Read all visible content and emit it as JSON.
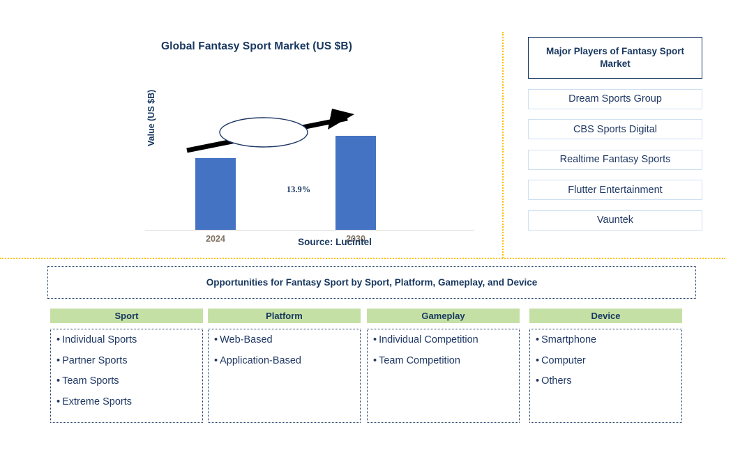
{
  "chart_data": {
    "type": "bar",
    "title": "Global Fantasy Sport Market (US $B)",
    "xlabel": "",
    "ylabel": "Value (US $B)",
    "categories": [
      "2024",
      "2030"
    ],
    "values": [
      71,
      93
    ],
    "ylim": [
      0,
      110
    ],
    "grid": false,
    "legend": null,
    "bar_color": "#4573c4",
    "annotations": [
      {
        "text": "13.9%",
        "kind": "cagr-callout-ellipse-with-arrow",
        "from_category": "2024",
        "to_category": "2030"
      }
    ],
    "source_note": "Source: Lucintel"
  },
  "chart": {
    "title": "Global Fantasy Sport Market (US $B)",
    "ylabel": "Value (US $B)",
    "cagr_label": "13.9%",
    "x_labels": [
      "2024",
      "2030"
    ],
    "source": "Source: Lucintel"
  },
  "players": {
    "header": "Major Players of Fantasy Sport Market",
    "items": [
      "Dream Sports Group",
      "CBS Sports Digital",
      "Realtime Fantasy Sports",
      "Flutter Entertainment",
      "Vauntek"
    ]
  },
  "opportunities": {
    "banner": "Opportunities for Fantasy Sport by Sport, Platform, Gameplay, and Device",
    "bullet": "•",
    "columns": [
      {
        "header": "Sport",
        "items": [
          "Individual Sports",
          "Partner Sports",
          "Team Sports",
          "Extreme Sports"
        ]
      },
      {
        "header": "Platform",
        "items": [
          "Web-Based",
          "Application-Based"
        ]
      },
      {
        "header": "Gameplay",
        "items": [
          "Individual Competition",
          "Team Competition"
        ]
      },
      {
        "header": "Device",
        "items": [
          "Smartphone",
          "Computer",
          "Others"
        ]
      }
    ]
  },
  "colors": {
    "navy": "#17375e",
    "bar_blue": "#4573c4",
    "header_green": "#c5e0a5",
    "divider_gold": "#ffc000",
    "player_border": "#cfe0f2",
    "axis_label": "#7f7262"
  }
}
